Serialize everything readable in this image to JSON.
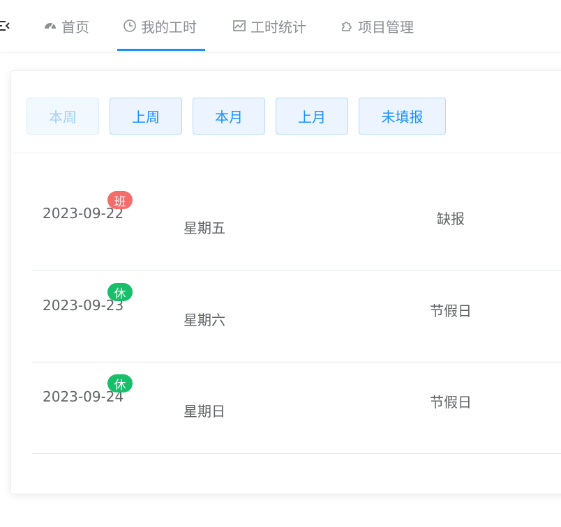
{
  "nav": {
    "tabs": [
      {
        "label": "首页",
        "icon": "dashboard-icon"
      },
      {
        "label": "我的工时",
        "icon": "clock-icon"
      },
      {
        "label": "工时统计",
        "icon": "chart-icon"
      },
      {
        "label": "项目管理",
        "icon": "puzzle-icon"
      }
    ],
    "active_tab": "我的工时"
  },
  "filters": {
    "this_week": "本周",
    "last_week": "上周",
    "this_month": "本月",
    "last_month": "上月",
    "not_reported": "未填报"
  },
  "rows": [
    {
      "date": "2023-09-22",
      "badge": "班",
      "badge_color": "#f56c6c",
      "weekday": "星期五",
      "status": "缺报"
    },
    {
      "date": "2023-09-23",
      "badge": "休",
      "badge_color": "#19be6b",
      "weekday": "星期六",
      "status": "节假日"
    },
    {
      "date": "2023-09-24",
      "badge": "休",
      "badge_color": "#19be6b",
      "weekday": "星期日",
      "status": "节假日"
    }
  ],
  "colors": {
    "accent": "#1890ff",
    "work_badge": "#f56c6c",
    "rest_badge": "#19be6b"
  }
}
